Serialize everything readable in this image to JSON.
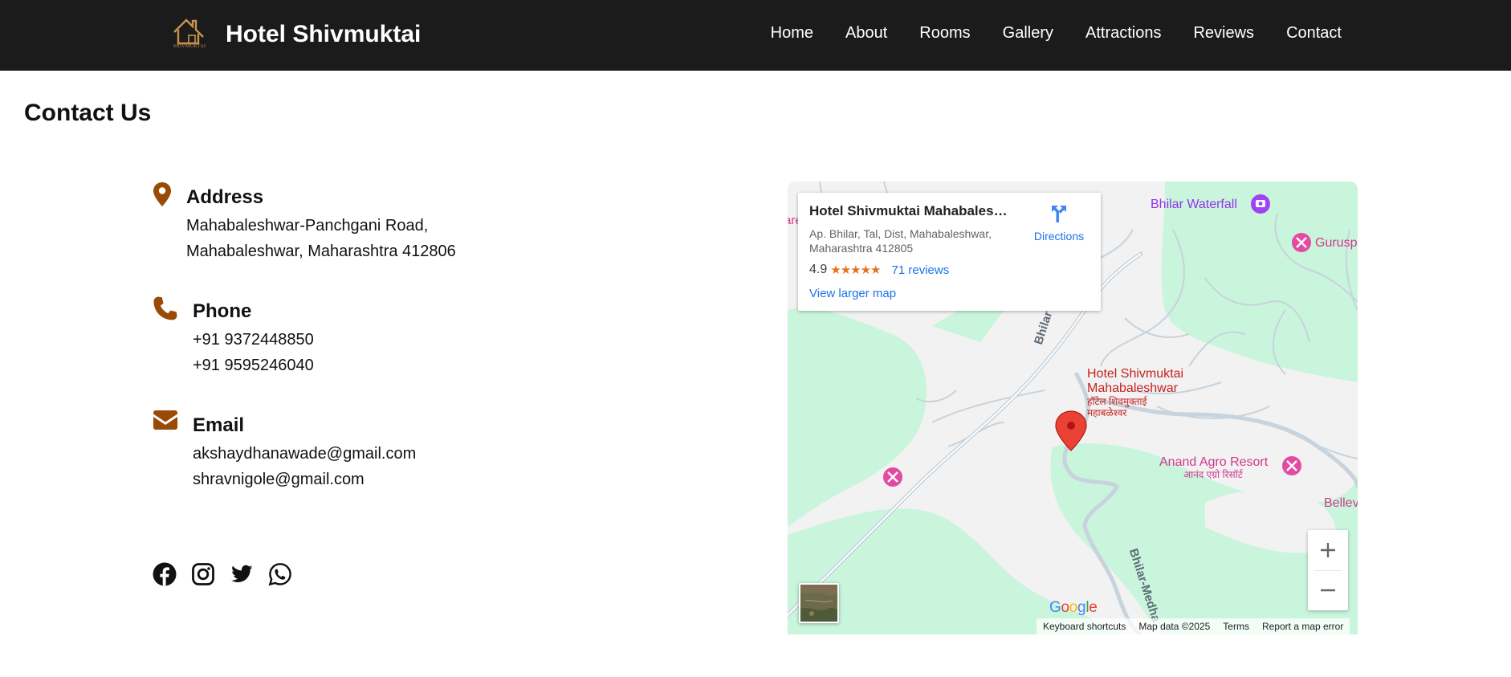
{
  "header": {
    "logo_text": "SHIVMUKTAI",
    "brand_name": "Hotel Shivmuktai",
    "nav": [
      "Home",
      "About",
      "Rooms",
      "Gallery",
      "Attractions",
      "Reviews",
      "Contact"
    ]
  },
  "contact": {
    "title": "Contact Us",
    "address": {
      "icon": "location-pin-icon",
      "title": "Address",
      "lines": [
        "Mahabaleshwar-Panchgani Road,",
        "Mahabaleshwar, Maharashtra 412806"
      ]
    },
    "phone": {
      "icon": "phone-icon",
      "title": "Phone",
      "lines": [
        "+91 9372448850",
        "+91 9595246040"
      ]
    },
    "email": {
      "icon": "envelope-icon",
      "title": "Email",
      "lines": [
        "akshaydhanawade@gmail.com",
        "shravnigole@gmail.com"
      ]
    },
    "social_icons": [
      "facebook-icon",
      "instagram-icon",
      "twitter-icon",
      "whatsapp-icon"
    ]
  },
  "map": {
    "place_name": "Hotel Shivmuktai Mahabalesh...",
    "place_address": "Ap. Bhilar, Tal, Dist, Mahabaleshwar, Maharashtra 412805",
    "rating": "4.9",
    "stars": "★★★★★",
    "reviews": "71 reviews",
    "view_larger": "View larger map",
    "directions": "Directions",
    "labels": {
      "waterfall": "Bhilar Waterfall",
      "gurusp": "Gurusp",
      "road1": "Bhilar Rd",
      "road2": "Bhilar-Medha",
      "marker_en_1": "Hotel Shivmuktai",
      "marker_en_2": "Mahabaleshwar",
      "marker_mr_1": "हॉटेल शिवमुक्ताई",
      "marker_mr_2": "महाबळेश्वर",
      "anand_en": "Anand Agro Resort",
      "anand_mr": "आनंद एग्रो रिसॉर्ट",
      "bellev": "Bellev",
      "edge_left": "are"
    },
    "google": "Google",
    "attribution": [
      "Keyboard shortcuts",
      "Map data ©2025",
      "Terms",
      "Report a map error"
    ],
    "colors": {
      "park": "#c9f5dc",
      "land": "#f2f2f2",
      "road": "#c7d3dd",
      "marker": "#ea4335",
      "poi": "#e34ba2"
    }
  },
  "colors": {
    "header_bg": "#1b1b1b",
    "accent_brown": "#9a4a07"
  }
}
